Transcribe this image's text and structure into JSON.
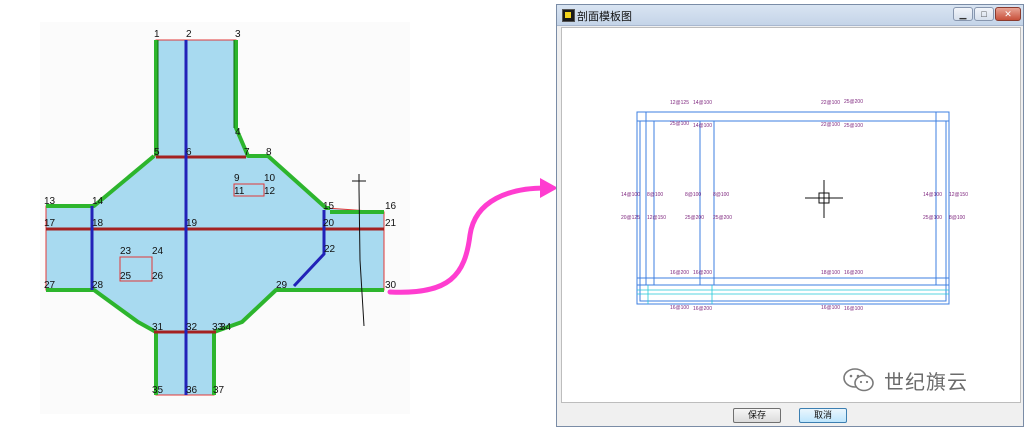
{
  "plan": {
    "node_numbers": [
      "1",
      "2",
      "3",
      "4",
      "5",
      "6",
      "7",
      "8",
      "9",
      "10",
      "11",
      "12",
      "13",
      "14",
      "15",
      "16",
      "17",
      "18",
      "19",
      "20",
      "21",
      "22",
      "23",
      "24",
      "25",
      "26",
      "27",
      "28",
      "29",
      "30",
      "31",
      "32",
      "33",
      "34",
      "35",
      "36",
      "37"
    ],
    "colors": {
      "fill": "#a8daf0",
      "outline": "#e03838",
      "wall_green": "#2db52d",
      "beam_red": "#a42121",
      "beam_blue": "#2222b8"
    }
  },
  "arrow": {
    "color": "#ff3dd0"
  },
  "dialog": {
    "title": "剖面模板图",
    "window_buttons": {
      "minimize": "▁",
      "maximize": "□",
      "close": "✕"
    },
    "section_labels": [
      "12@125",
      "14@100",
      "25@100",
      "14@100",
      "22@100",
      "25@200",
      "22@100",
      "25@100",
      "14@100",
      "8@100",
      "20@125",
      "12@150",
      "8@100",
      "8@100",
      "25@200",
      "25@200",
      "14@100",
      "12@150",
      "25@100",
      "8@100",
      "16@200",
      "16@200",
      "18@100",
      "16@200",
      "16@100",
      "16@200",
      "16@100",
      "16@100"
    ],
    "buttons": {
      "save": "保存",
      "cancel": "取消"
    }
  },
  "watermark": {
    "text": "世纪旗云"
  }
}
